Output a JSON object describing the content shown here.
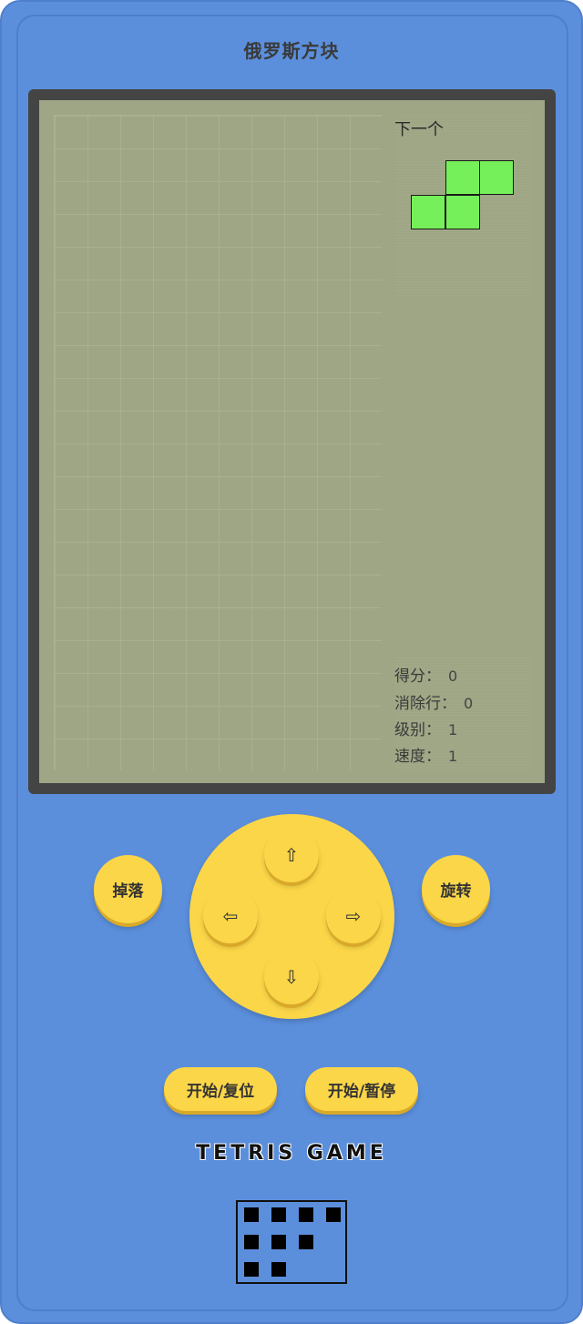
{
  "title": "俄罗斯方块",
  "next_panel": {
    "label": "下一个",
    "piece": "S",
    "piece_color": "#76f05a",
    "cells": [
      [
        1,
        0
      ],
      [
        2,
        0
      ],
      [
        0,
        1
      ],
      [
        1,
        1
      ]
    ]
  },
  "board": {
    "columns": 10,
    "rows": 20,
    "blocks": []
  },
  "stats": {
    "score_label": "得分：",
    "score": "0",
    "lines_label": "消除行：",
    "lines": "0",
    "level_label": "级别：",
    "level": "1",
    "speed_label": "速度：",
    "speed": "1"
  },
  "controls": {
    "drop_label": "掉落",
    "rotate_label": "旋转",
    "up_icon": "⇧",
    "left_icon": "⇦",
    "right_icon": "⇨",
    "down_icon": "⇩",
    "start_reset_label": "开始/复位",
    "start_pause_label": "开始/暂停"
  },
  "brand": "TETRIS GAME",
  "logo_pattern": [
    [
      1,
      1,
      1,
      1
    ],
    [
      1,
      1,
      1,
      0
    ],
    [
      1,
      1,
      0,
      0
    ]
  ],
  "colors": {
    "body": "#5b8fdc",
    "button": "#fbd648",
    "screen": "#9ea685",
    "screen_frame": "#444444"
  }
}
